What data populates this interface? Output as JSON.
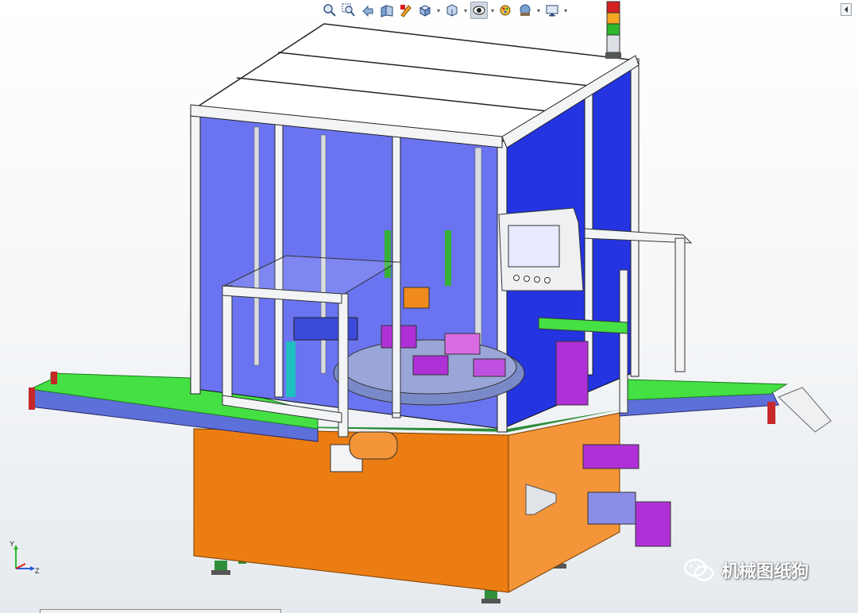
{
  "app": {
    "type": "cad-3d-viewport"
  },
  "toolbar": {
    "tools": [
      {
        "icon": "zoom-to-fit-icon",
        "has_dropdown": false
      },
      {
        "icon": "zoom-to-area-icon",
        "has_dropdown": false
      },
      {
        "icon": "previous-view-icon",
        "has_dropdown": false
      },
      {
        "icon": "section-view-icon",
        "has_dropdown": false
      },
      {
        "icon": "dynamic-annotation-icon",
        "has_dropdown": false
      },
      {
        "icon": "view-orientation-icon",
        "has_dropdown": true
      },
      {
        "icon": "display-style-icon",
        "has_dropdown": true
      },
      {
        "icon": "hide-show-items-icon",
        "has_dropdown": true,
        "active": true
      },
      {
        "icon": "edit-appearance-icon",
        "has_dropdown": false
      },
      {
        "icon": "apply-scene-icon",
        "has_dropdown": true
      },
      {
        "icon": "view-settings-icon",
        "has_dropdown": true
      }
    ]
  },
  "triad": {
    "x_label": "",
    "y_label": "Y",
    "z_label": "Z"
  },
  "watermark": {
    "text": "机械图纸狗",
    "icon": "wechat-icon"
  },
  "colors": {
    "frame": "#f2f4f6",
    "glass_blue": "#4a5ae8",
    "base_orange": "#ec7d12",
    "conveyor_green": "#44e044",
    "conveyor_blue": "#5d6fd8",
    "part_purple": "#b030d8",
    "light_red": "#d62020",
    "light_orange": "#f5a623",
    "light_green": "#2eb82e"
  }
}
